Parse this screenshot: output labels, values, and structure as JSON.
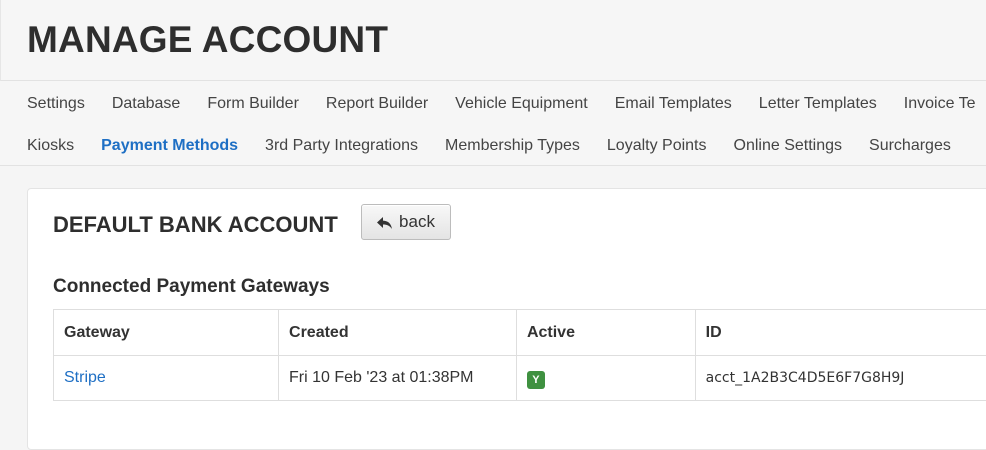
{
  "header": {
    "title": "MANAGE ACCOUNT"
  },
  "nav": {
    "row1": [
      "Settings",
      "Database",
      "Form Builder",
      "Report Builder",
      "Vehicle Equipment",
      "Email Templates",
      "Letter Templates",
      "Invoice Te"
    ],
    "row2": [
      "Kiosks",
      "Payment Methods",
      "3rd Party Integrations",
      "Membership Types",
      "Loyalty Points",
      "Online Settings",
      "Surcharges"
    ],
    "active": "Payment Methods",
    "active_color": "#1e6fc4"
  },
  "panel": {
    "heading": "DEFAULT BANK ACCOUNT",
    "back_label": "back",
    "back_icon": "reply-arrow-icon",
    "section_heading": "Connected Payment Gateways",
    "table": {
      "headers": [
        "Gateway",
        "Created",
        "Active",
        "ID"
      ],
      "rows": [
        {
          "gateway": "Stripe",
          "created": "Fri 10 Feb '23 at 01:38PM",
          "active": "Y",
          "id": "acct_1A2B3C4D5E6F7G8H9J"
        }
      ]
    },
    "badge_color": "#3f9140",
    "link_color": "#1e6fc4"
  }
}
